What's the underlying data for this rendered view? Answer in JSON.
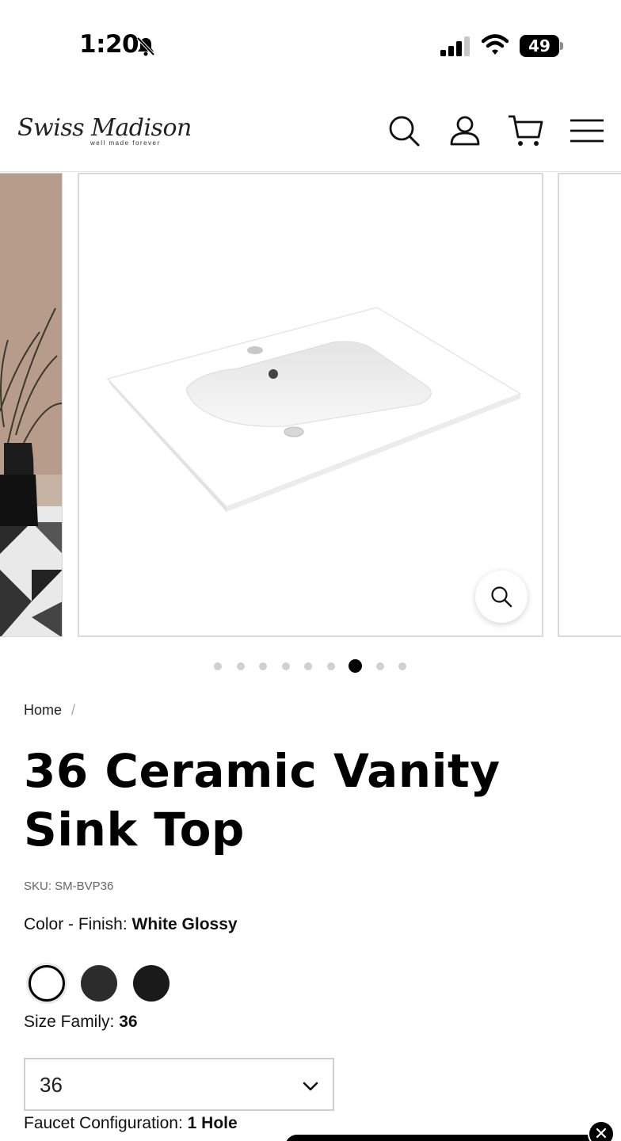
{
  "status_bar": {
    "time": "1:20",
    "battery": "49"
  },
  "header": {
    "logo": "Swiss Madison",
    "logo_tagline": "well made forever",
    "icons": [
      "search-icon",
      "account-icon",
      "cart-icon",
      "menu-icon"
    ]
  },
  "gallery": {
    "slide_count": 9,
    "active_slide_index": 6
  },
  "breadcrumb": {
    "home": "Home",
    "separator": "/"
  },
  "product": {
    "title": "36 Ceramic Vanity Sink Top",
    "sku": "SKU: SM-BVP36",
    "color_finish": {
      "label": "Color - Finish:",
      "value": "White Glossy"
    },
    "swatches": [
      {
        "name": "White Glossy",
        "color": "#ffffff",
        "selected": true
      },
      {
        "name": "swatch-2",
        "color": "#2c2c2c",
        "selected": false
      },
      {
        "name": "swatch-3",
        "color": "#1a1a1a",
        "selected": false
      }
    ],
    "size_family": {
      "label": "Size Family:",
      "value": "36"
    },
    "size_select": {
      "value": "36"
    },
    "faucet": {
      "label": "Faucet Configuration:",
      "value": "1 Hole"
    }
  },
  "colors": {
    "accent": "#000000",
    "border": "#d9d9d9"
  }
}
